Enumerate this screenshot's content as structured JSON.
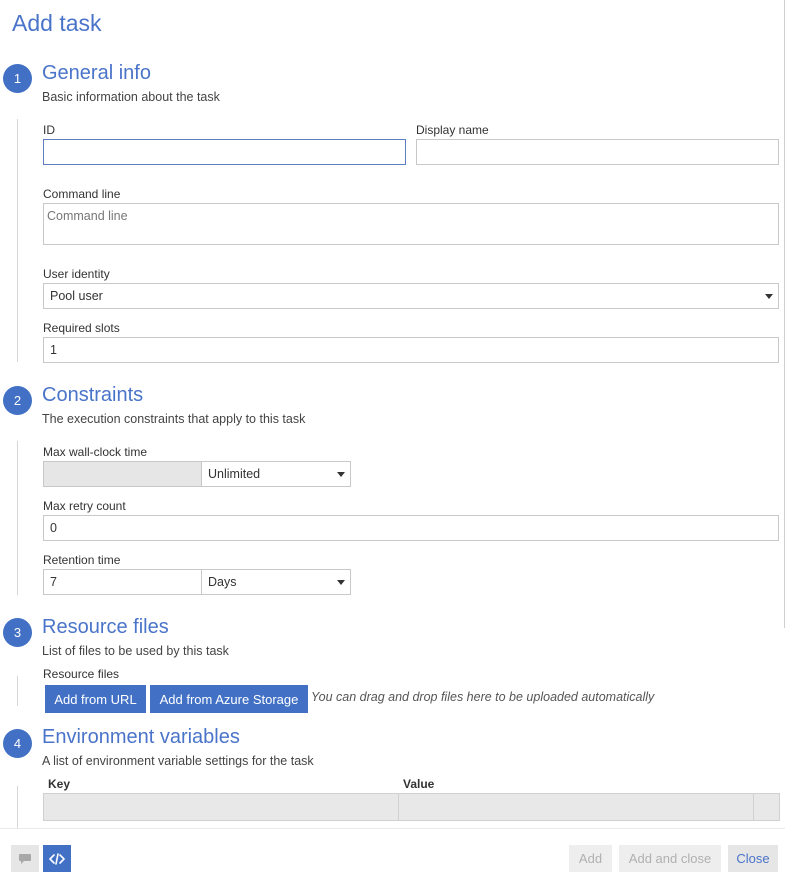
{
  "page": {
    "title": "Add task"
  },
  "sections": [
    {
      "number": "1",
      "title": "General info",
      "description": "Basic information about the task"
    },
    {
      "number": "2",
      "title": "Constraints",
      "description": "The execution constraints that apply to this task"
    },
    {
      "number": "3",
      "title": "Resource files",
      "description": "List of files to be used by this task"
    },
    {
      "number": "4",
      "title": "Environment variables",
      "description": "A list of environment variable settings for the task"
    }
  ],
  "general": {
    "id_label": "ID",
    "id_value": "",
    "display_name_label": "Display name",
    "display_name_value": "",
    "command_line_label": "Command line",
    "command_line_placeholder": "Command line",
    "user_identity_label": "User identity",
    "user_identity_value": "Pool user",
    "required_slots_label": "Required slots",
    "required_slots_value": "1"
  },
  "constraints": {
    "max_wall_clock_label": "Max wall-clock time",
    "max_wall_clock_value": "",
    "max_wall_clock_unit": "Unlimited",
    "max_retry_label": "Max retry count",
    "max_retry_value": "0",
    "retention_label": "Retention time",
    "retention_value": "7",
    "retention_unit": "Days"
  },
  "resource_files": {
    "label": "Resource files",
    "add_from_url": "Add from URL",
    "add_from_storage": "Add from Azure Storage",
    "drop_hint": "You can drag and drop files here to be uploaded automatically"
  },
  "env_vars": {
    "key_header": "Key",
    "value_header": "Value"
  },
  "footer": {
    "add": "Add",
    "add_and_close": "Add and close",
    "close": "Close"
  },
  "icons": {
    "feedback": "chat-bubble-icon",
    "code": "code-icon"
  },
  "colors": {
    "accent": "#4170c5",
    "title": "#4a74c9"
  }
}
